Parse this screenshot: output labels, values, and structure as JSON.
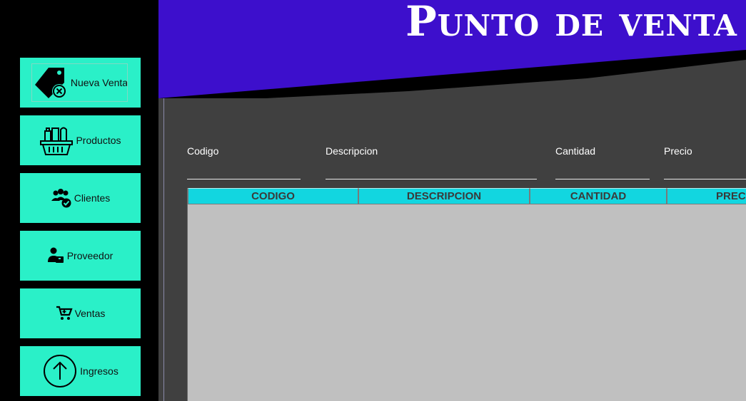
{
  "header": {
    "title": "Punto de venta",
    "colors": {
      "banner": "#3d0fcc",
      "dark": "#404040"
    }
  },
  "sidebar": {
    "items": [
      {
        "label": "Nueva Venta",
        "icon": "price-tag-cancel-icon"
      },
      {
        "label": "Productos",
        "icon": "grocery-basket-icon"
      },
      {
        "label": "Clientes",
        "icon": "users-check-icon"
      },
      {
        "label": "Proveedor",
        "icon": "supplier-icon"
      },
      {
        "label": "Ventas",
        "icon": "shopping-cart-icon"
      },
      {
        "label": "Ingresos",
        "icon": "arrow-up-circle-icon"
      }
    ],
    "accent": "#2af0c8"
  },
  "form": {
    "codigo_label": "Codigo",
    "descripcion_label": "Descripcion",
    "cantidad_label": "Cantidad",
    "precio_label": "Precio",
    "codigo_value": "",
    "descripcion_value": "",
    "cantidad_value": "",
    "precio_value": ""
  },
  "table": {
    "columns": [
      "CODIGO",
      "DESCRIPCION",
      "CANTIDAD",
      "PRECIO"
    ],
    "rows": [],
    "header_color": "#12d6e0"
  }
}
